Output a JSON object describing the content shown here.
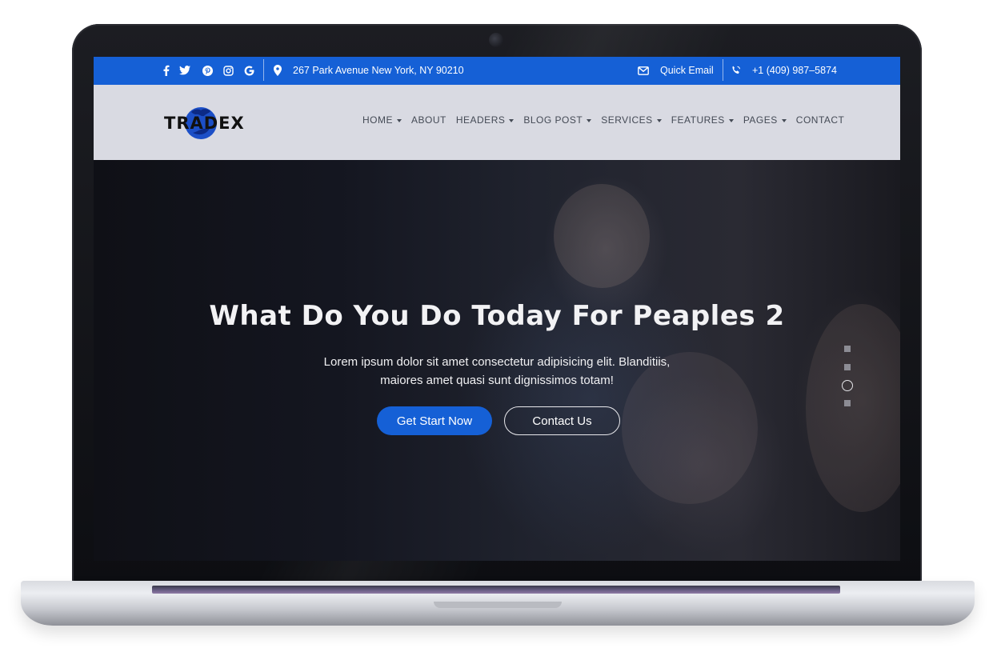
{
  "topbar": {
    "social_icons": [
      "facebook-icon",
      "twitter-icon",
      "pinterest-icon",
      "instagram-icon",
      "google-icon"
    ],
    "address": "267 Park Avenue New York, NY 90210",
    "email_label": "Quick Email",
    "phone": "+1 (409) 987–5874"
  },
  "navbar": {
    "logo_text": "TRADEX",
    "items": [
      {
        "label": "HOME",
        "dropdown": true
      },
      {
        "label": "ABOUT",
        "dropdown": false
      },
      {
        "label": "HEADERS",
        "dropdown": true
      },
      {
        "label": "BLOG POST",
        "dropdown": true
      },
      {
        "label": "SERVICES",
        "dropdown": true
      },
      {
        "label": "FEATURES",
        "dropdown": true
      },
      {
        "label": "PAGES",
        "dropdown": true
      },
      {
        "label": "CONTACT",
        "dropdown": false
      }
    ]
  },
  "hero": {
    "title": "What Do You Do Today For Peaples 2",
    "subtitle_line1": "Lorem ipsum dolor sit amet consectetur adipisicing elit. Blanditiis,",
    "subtitle_line2": "maiores amet quasi sunt dignissimos totam!",
    "primary_button": "Get Start Now",
    "secondary_button": "Contact Us",
    "slides_total": 4,
    "active_slide": 3
  },
  "colors": {
    "accent": "#1560d6",
    "navbar_bg": "#d9dae2",
    "hero_text": "#f2f2f4"
  }
}
